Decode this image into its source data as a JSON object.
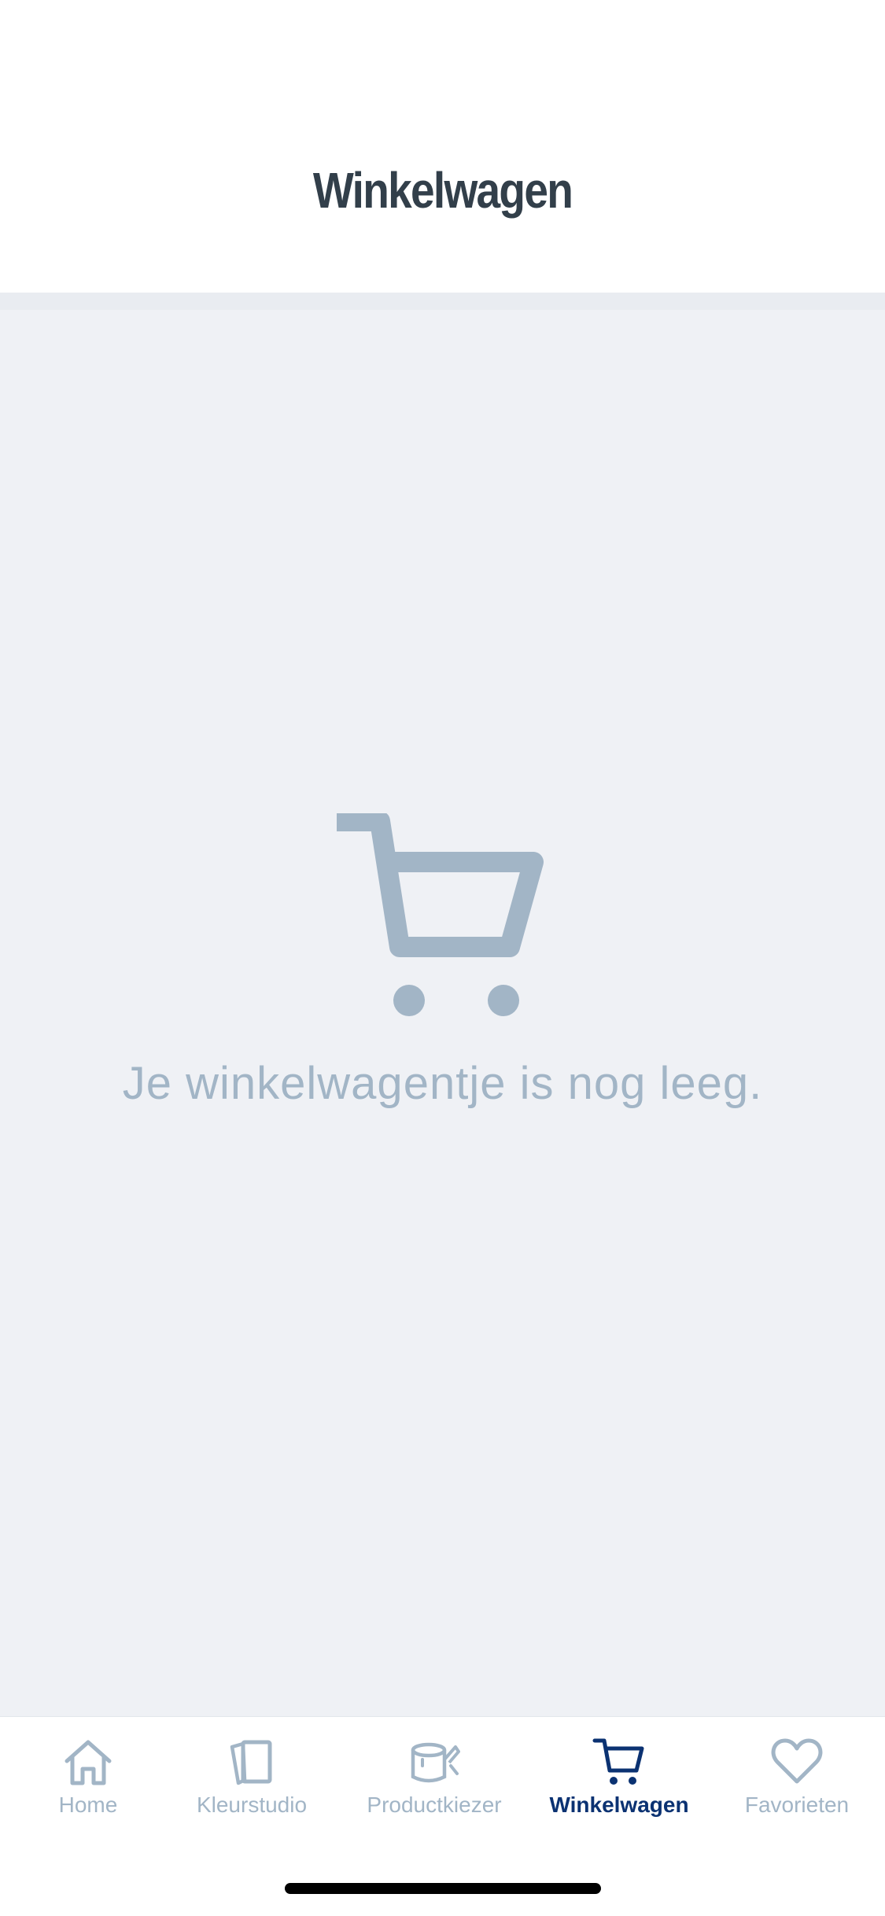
{
  "header": {
    "title": "Winkelwagen"
  },
  "empty_state": {
    "icon": "cart-icon",
    "message": "Je winkelwagentje is nog leeg."
  },
  "tabbar": {
    "tabs": [
      {
        "label": "Home",
        "icon": "home-icon",
        "active": false
      },
      {
        "label": "Kleurstudio",
        "icon": "color-cards-icon",
        "active": false
      },
      {
        "label": "Productkiezer",
        "icon": "paint-bucket-icon",
        "active": false
      },
      {
        "label": "Winkelwagen",
        "icon": "cart-icon",
        "active": true
      },
      {
        "label": "Favorieten",
        "icon": "heart-icon",
        "active": false
      }
    ]
  },
  "colors": {
    "title_text": "#323f4a",
    "content_bg": "#eff1f5",
    "muted": "#a2b5c6",
    "active": "#0b3272"
  }
}
